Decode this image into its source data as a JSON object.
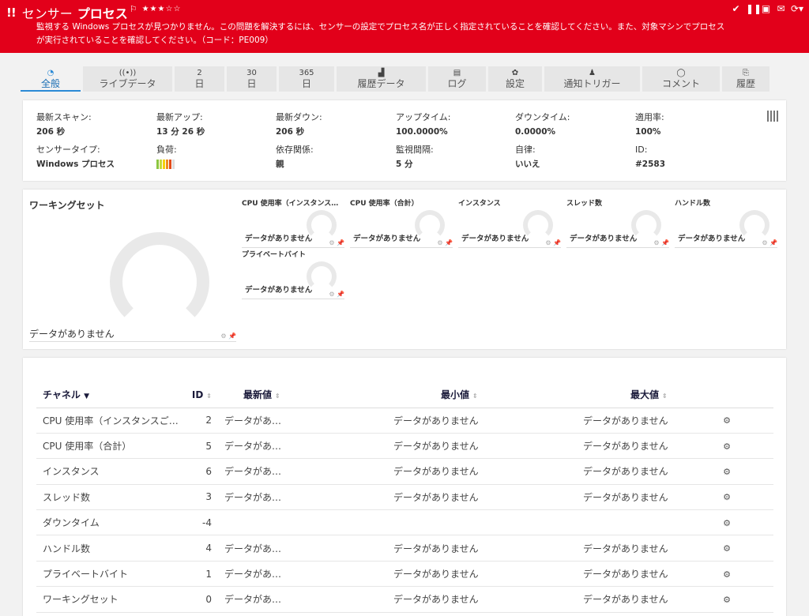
{
  "header": {
    "bang": "!!",
    "title_prefix": "センサー",
    "title_main": "プロセス",
    "flag": "⚐",
    "stars": "★★★☆☆",
    "message": "監視する Windows プロセスが見つかりません。この問題を解決するには、センサーの設定でプロセス名が正しく指定されていることを確認してください。また、対象マシンでプロセスが実行されていることを確認してください。（コード：PE009）",
    "icons": [
      "check-icon",
      "pause-icon",
      "document-icon",
      "mail-icon",
      "refresh-icon"
    ]
  },
  "tabs": [
    {
      "icon": "◔",
      "label": "全般",
      "active": true
    },
    {
      "icon": "((•))",
      "label": "ライブデータ"
    },
    {
      "icon": "2",
      "label": "日"
    },
    {
      "icon": "30",
      "label": "日"
    },
    {
      "icon": "365",
      "label": "日"
    },
    {
      "icon": "▟",
      "label": "履歴データ"
    },
    {
      "icon": "▤",
      "label": "ログ"
    },
    {
      "icon": "✿",
      "label": "設定"
    },
    {
      "icon": "♟",
      "label": "通知トリガー"
    },
    {
      "icon": "◯",
      "label": "コメント"
    },
    {
      "icon": "⎘",
      "label": "履歴"
    }
  ],
  "info": {
    "last_scan": {
      "label": "最新スキャン:",
      "value": "206 秒"
    },
    "last_up": {
      "label": "最新アップ:",
      "value": "13 分 26 秒"
    },
    "last_down": {
      "label": "最新ダウン:",
      "value": "206 秒"
    },
    "uptime": {
      "label": "アップタイム:",
      "value": "100.0000%"
    },
    "downtime": {
      "label": "ダウンタイム:",
      "value": "0.0000%"
    },
    "coverage": {
      "label": "適用率:",
      "value": "100%"
    },
    "sensor_type": {
      "label": "センサータイプ:",
      "value": "Windows プロセス"
    },
    "load": {
      "label": "負荷:",
      "colors": [
        "#8cc63f",
        "#c7d93b",
        "#f5d10a",
        "#f08c1a",
        "#e24a1a",
        "#dddddd"
      ]
    },
    "dependency": {
      "label": "依存関係:",
      "value": "親"
    },
    "interval": {
      "label": "監視間隔:",
      "value": "5 分"
    },
    "autonomy": {
      "label": "自律:",
      "value": "いいえ"
    },
    "id": {
      "label": "ID:",
      "value": "#2583"
    }
  },
  "gauges": {
    "big": {
      "title": "ワーキングセット",
      "nodata": "データがありません"
    },
    "small": [
      {
        "title": "CPU 使用率（インスタンスご…",
        "nodata": "データがありません"
      },
      {
        "title": "CPU 使用率（合計）",
        "nodata": "データがありません"
      },
      {
        "title": "インスタンス",
        "nodata": "データがありません"
      },
      {
        "title": "スレッド数",
        "nodata": "データがありません"
      },
      {
        "title": "ハンドル数",
        "nodata": "データがありません"
      },
      {
        "title": "プライベートバイト",
        "nodata": "データがありません"
      }
    ]
  },
  "table": {
    "headers": {
      "channel": "チャネル",
      "id": "ID",
      "latest": "最新値",
      "min": "最小値",
      "max": "最大値"
    },
    "rows": [
      {
        "channel": "CPU 使用率（インスタンスご…",
        "id": "2",
        "latest": "データがあ…",
        "min": "データがありません",
        "max": "データがありません"
      },
      {
        "channel": "CPU 使用率（合計）",
        "id": "5",
        "latest": "データがあ…",
        "min": "データがありません",
        "max": "データがありません"
      },
      {
        "channel": "インスタンス",
        "id": "6",
        "latest": "データがあ…",
        "min": "データがありません",
        "max": "データがありません"
      },
      {
        "channel": "スレッド数",
        "id": "3",
        "latest": "データがあ…",
        "min": "データがありません",
        "max": "データがありません"
      },
      {
        "channel": "ダウンタイム",
        "id": "-4",
        "latest": "",
        "min": "",
        "max": ""
      },
      {
        "channel": "ハンドル数",
        "id": "4",
        "latest": "データがあ…",
        "min": "データがありません",
        "max": "データがありません"
      },
      {
        "channel": "プライベートバイト",
        "id": "1",
        "latest": "データがあ…",
        "min": "データがありません",
        "max": "データがありません"
      },
      {
        "channel": "ワーキングセット",
        "id": "0",
        "latest": "データがあ…",
        "min": "データがありません",
        "max": "データがありません"
      }
    ]
  }
}
